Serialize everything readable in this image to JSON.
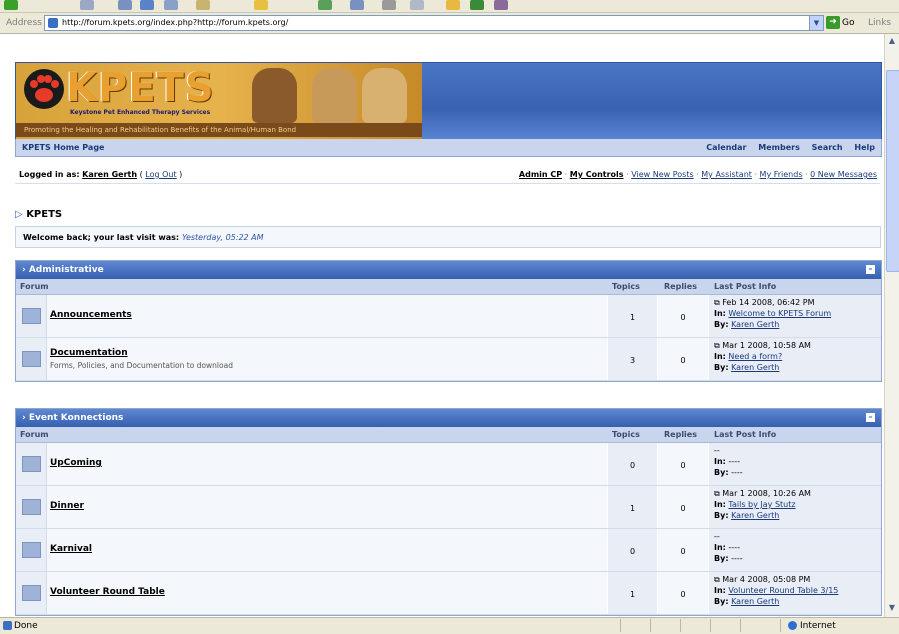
{
  "browser": {
    "address_label": "Address",
    "url": "http://forum.kpets.org/index.php?http://forum.kpets.org/",
    "go_label": "Go",
    "links_label": "Links",
    "status_text": "Done",
    "zone_text": "Internet"
  },
  "site": {
    "logo_text": "KPETS",
    "logo_subtitle": "Keystone Pet Enhanced Therapy Services",
    "logo_tagline": "Promoting the Healing and Rehabilitation Benefits of the Animal/Human Bond"
  },
  "nav": {
    "home": "KPETS Home Page",
    "links": [
      "Calendar",
      "Members",
      "Search",
      "Help"
    ]
  },
  "userbar": {
    "logged_in_prefix": "Logged in as:",
    "user_name": "Karen Gerth",
    "logout": "Log Out",
    "admin_cp": "Admin CP",
    "my_controls": "My Controls",
    "view_new_posts": "View New Posts",
    "my_assistant": "My Assistant",
    "my_friends": "My Friends",
    "new_messages": "0 New Messages"
  },
  "breadcrumb": "KPETS",
  "welcome": {
    "text": "Welcome back; your last visit was:",
    "date": "Yesterday, 05:22 AM"
  },
  "columns": {
    "forum": "Forum",
    "topics": "Topics",
    "replies": "Replies",
    "last_post": "Last Post Info"
  },
  "categories": [
    {
      "title": "Administrative",
      "forums": [
        {
          "name": "Announcements",
          "description": "",
          "topics": "1",
          "replies": "0",
          "last_date": "Feb 14 2008, 06:42 PM",
          "in_label": "In:",
          "in_topic": "Welcome to KPETS Forum",
          "by_label": "By:",
          "by_user": "Karen Gerth"
        },
        {
          "name": "Documentation",
          "description": "Forms, Policies, and Documentation to download",
          "topics": "3",
          "replies": "0",
          "last_date": "Mar 1 2008, 10:58 AM",
          "in_label": "In:",
          "in_topic": "Need a form?",
          "by_label": "By:",
          "by_user": "Karen Gerth"
        }
      ]
    },
    {
      "title": "Event Konnections",
      "forums": [
        {
          "name": "UpComing",
          "description": "",
          "topics": "0",
          "replies": "0",
          "last_date": "--",
          "in_label": "In:",
          "in_topic": "----",
          "by_label": "By:",
          "by_user": "----"
        },
        {
          "name": "Dinner",
          "description": "",
          "topics": "1",
          "replies": "0",
          "last_date": "Mar 1 2008, 10:26 AM",
          "in_label": "In:",
          "in_topic": "Tails by Jay Stutz",
          "by_label": "By:",
          "by_user": "Karen Gerth"
        },
        {
          "name": "Karnival",
          "description": "",
          "topics": "0",
          "replies": "0",
          "last_date": "--",
          "in_label": "In:",
          "in_topic": "----",
          "by_label": "By:",
          "by_user": "----"
        },
        {
          "name": "Volunteer Round Table",
          "description": "",
          "topics": "1",
          "replies": "0",
          "last_date": "Mar 4 2008, 05:08 PM",
          "in_label": "In:",
          "in_topic": "Volunteer Round Table 3/15",
          "by_label": "By:",
          "by_user": "Karen Gerth"
        }
      ]
    }
  ]
}
